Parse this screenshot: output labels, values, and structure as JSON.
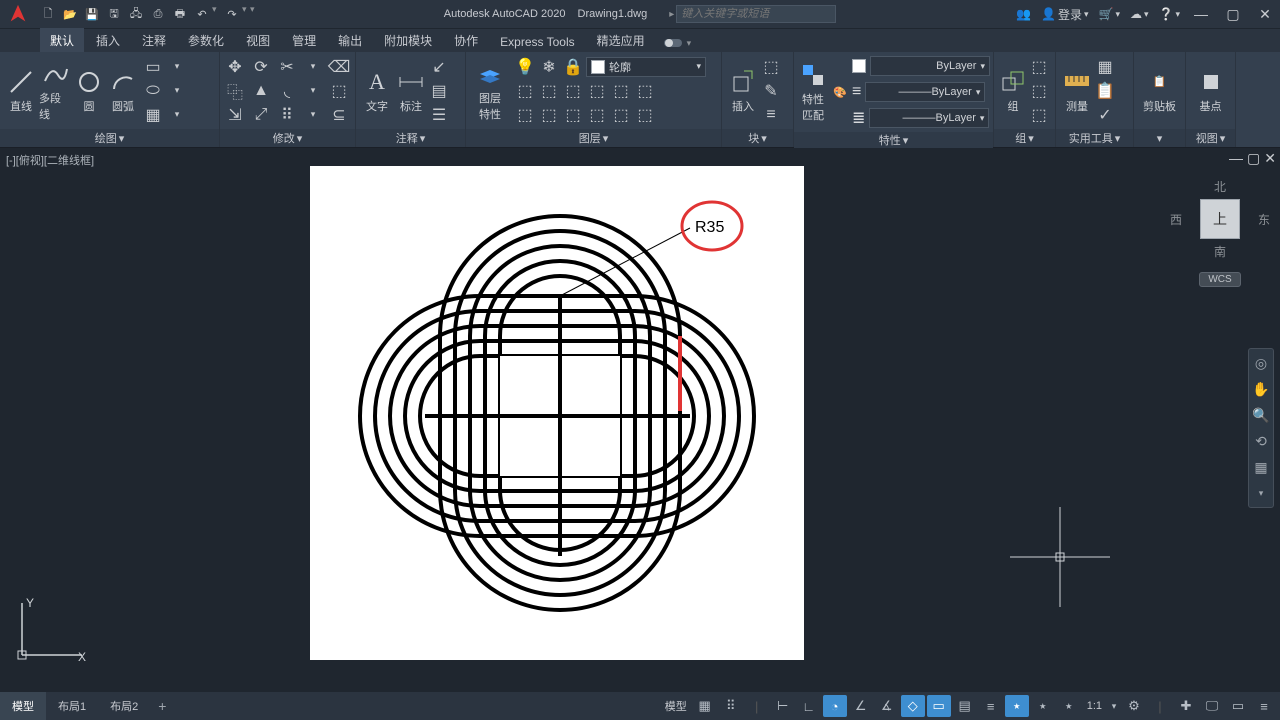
{
  "title": {
    "app": "Autodesk AutoCAD 2020",
    "doc": "Drawing1.dwg"
  },
  "search": {
    "placeholder": "键入关键字或短语"
  },
  "account": {
    "login": "登录"
  },
  "tabs": [
    "默认",
    "插入",
    "注释",
    "参数化",
    "视图",
    "管理",
    "输出",
    "附加模块",
    "协作",
    "Express Tools",
    "精选应用"
  ],
  "active_tab": "默认",
  "draw": {
    "line": "直线",
    "polyline": "多段线",
    "circle": "圆",
    "arc": "圆弧",
    "panel": "绘图"
  },
  "modify": {
    "panel": "修改"
  },
  "annot": {
    "text": "文字",
    "dim": "标注",
    "panel": "注释"
  },
  "layerp": {
    "panel": "图层",
    "props": "图层\n特性",
    "combo": "轮廓"
  },
  "block": {
    "insert": "插入",
    "panel": "块"
  },
  "props": {
    "match": "特性\n匹配",
    "panel": "特性",
    "bylayer": "ByLayer"
  },
  "group": {
    "label": "组",
    "panel": "组"
  },
  "util": {
    "measure": "测量",
    "panel": "实用工具"
  },
  "clip": {
    "label": "剪贴板"
  },
  "base": {
    "label": "基点"
  },
  "view": {
    "panel": "视图"
  },
  "viewport": {
    "label": "[-][俯视][二维线框]"
  },
  "cube": {
    "n": "北",
    "s": "南",
    "e": "东",
    "w": "西",
    "top": "上",
    "wcs": "WCS"
  },
  "layouts": {
    "model": "模型",
    "l1": "布局1",
    "l2": "布局2"
  },
  "status": {
    "modeltxt": "模型",
    "scale": "1:1"
  },
  "annotation": {
    "radius": "R35"
  },
  "ucs": {
    "x": "X",
    "y": "Y"
  }
}
